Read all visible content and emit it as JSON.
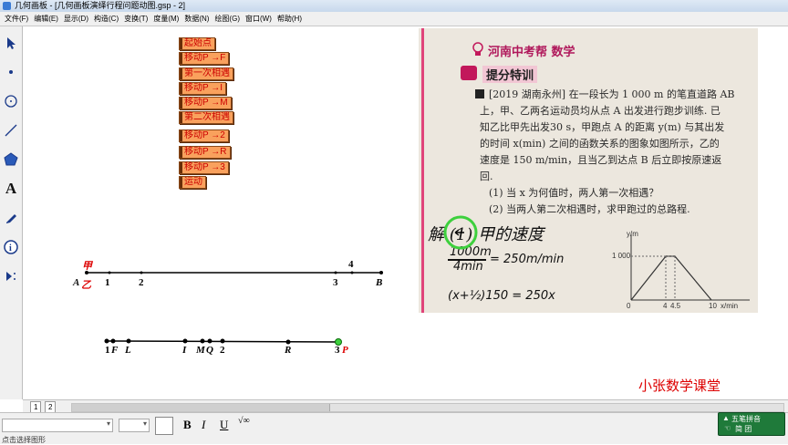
{
  "window": {
    "title": "几何画板 - [几何画板演绎行程问题动图.gsp - 2]"
  },
  "menu": [
    "文件(F)",
    "编辑(E)",
    "显示(D)",
    "构造(C)",
    "变换(T)",
    "度量(M)",
    "数据(N)",
    "绘图(G)",
    "窗口(W)",
    "帮助(H)"
  ],
  "tools": [
    "arrow-select-icon",
    "point-icon",
    "compass-circle-icon",
    "straightedge-icon",
    "polygon-icon",
    "text-tool-icon",
    "marker-pen-icon",
    "info-icon",
    "custom-tool-icon"
  ],
  "buttons": [
    "起始点",
    "移动P →F",
    "第一次相遇",
    "移动P →I",
    "移动P →M",
    "第二次相遇",
    "移动P →2",
    "移动P →R",
    "移动P →3",
    "运动"
  ],
  "line1": {
    "jia": "甲",
    "A": "A",
    "yi": "乙",
    "t1": "1",
    "t2": "2",
    "t3": "3",
    "t4": "4",
    "B": "B"
  },
  "line2": {
    "t1": "1",
    "F": "F",
    "L": "L",
    "I": "I",
    "M": "M",
    "Q": "Q",
    "t2": "2",
    "R": "R",
    "t3": "3",
    "P": "P"
  },
  "photo": {
    "header": "河南中考帮 数学",
    "section": "提分特训",
    "problem_lines": [
      "[2019 湖南永州] 在一段长为 1 000 m 的笔直道路 AB",
      "上，甲、乙两名运动员均从点 A 出发进行跑步训练. 已",
      "知乙比甲先出发30 s，甲跑点 A 的距离 y(m) 与其出发",
      "的时间 x(min) 之间的函数关系的图象如图所示，乙的",
      "速度是 150 m/min，且当乙到达点 B 后立即按原速返",
      "回.",
      "(1) 当 x 为何值时，两人第一次相遇？",
      "(2) 当两人第二次相遇时，求甲跑过的总路程."
    ],
    "hw1": "解 (1) 甲的速度",
    "hw2": "1000m",
    "hw3": "4min",
    "hw4": "= 250m/min",
    "hw5": "(x+½)150 = 250x",
    "graph": {
      "ylabel": "y/m",
      "y1000": "1 000",
      "x_ticks": [
        "0",
        "4",
        "4.5",
        "10"
      ],
      "xlabel": "x/min"
    }
  },
  "tabs": [
    "1",
    "2"
  ],
  "brand": "小张数学课堂",
  "ime": {
    "name": "五笔拼音",
    "row2": "简 团"
  },
  "status": {
    "left": "点击选择图形"
  }
}
